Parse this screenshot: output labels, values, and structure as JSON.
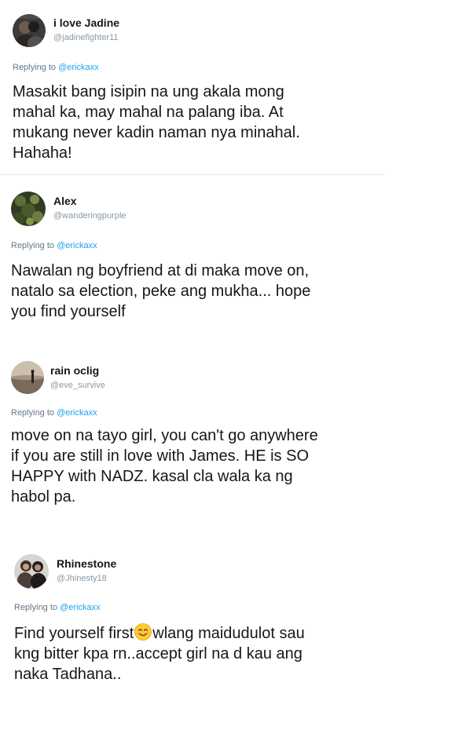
{
  "replies": [
    {
      "display_name": "i love Jadine",
      "handle": "@jadinefighter11",
      "replying_prefix": "Replying to ",
      "replying_to": "@erickaxx",
      "text": "Masakit bang isipin na ung akala mong\nmahal ka, may mahal na palang iba. At\nmukang never kadin naman nya minahal.\nHahaha!",
      "avatar_icon": "user-avatar-photo"
    },
    {
      "display_name": "Alex",
      "handle": "@wanderingpurple",
      "replying_prefix": "Replying to ",
      "replying_to": "@erickaxx",
      "text": "Nawalan ng boyfriend at di maka move on,\nnatalo sa election, peke ang mukha... hope\nyou find yourself",
      "avatar_icon": "user-avatar-photo"
    },
    {
      "display_name": "rain oclig",
      "handle": "@eve_survive",
      "replying_prefix": "Replying to ",
      "replying_to": "@erickaxx",
      "text": "move on na tayo girl, you can't go anywhere\nif you are still in love with James. HE is SO\nHAPPY with NADZ. kasal cla wala ka ng\nhabol pa.",
      "avatar_icon": "user-avatar-photo"
    },
    {
      "display_name": "Rhinestone",
      "handle": "@Jhinesty18",
      "replying_prefix": "Replying to ",
      "replying_to": "@erickaxx",
      "text_before_emoji": "Find yourself first",
      "emoji": "smiling-face-emoji",
      "text_after_emoji": "wlang maidudulot sau\nkng bitter kpa rn..accept girl na d kau ang\nnaka Tadhana..",
      "avatar_icon": "user-avatar-photo"
    }
  ],
  "colors": {
    "name": "#14171a",
    "handle": "#8899a6",
    "replying": "#657786",
    "link": "#1da1f2",
    "divider": "#e6ecf0"
  }
}
